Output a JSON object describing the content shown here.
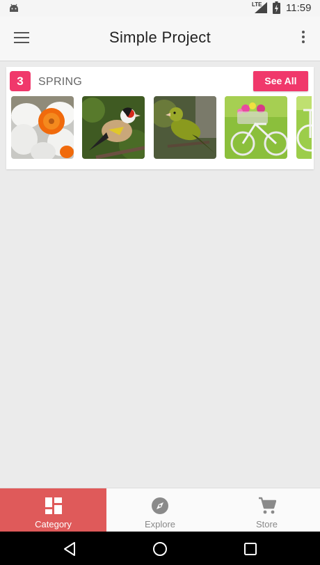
{
  "status_bar": {
    "network_label": "LTE",
    "time": "11:59"
  },
  "app_bar": {
    "title": "Simple Project"
  },
  "section": {
    "count": "3",
    "title": "SPRING",
    "see_all_label": "See All",
    "thumbnails": [
      {
        "subject": "daffodil flower"
      },
      {
        "subject": "goldfinch bird"
      },
      {
        "subject": "greenfinch bird"
      },
      {
        "subject": "bicycle with flower basket"
      },
      {
        "subject": "bicycle in meadow"
      }
    ]
  },
  "bottom_nav": {
    "items": [
      {
        "label": "Category",
        "icon": "grid-icon",
        "active": true
      },
      {
        "label": "Explore",
        "icon": "compass-icon",
        "active": false
      },
      {
        "label": "Store",
        "icon": "cart-icon",
        "active": false
      }
    ]
  },
  "colors": {
    "accent": "#f0386b",
    "active_tab": "#df5a5a",
    "background": "#ebebeb"
  }
}
